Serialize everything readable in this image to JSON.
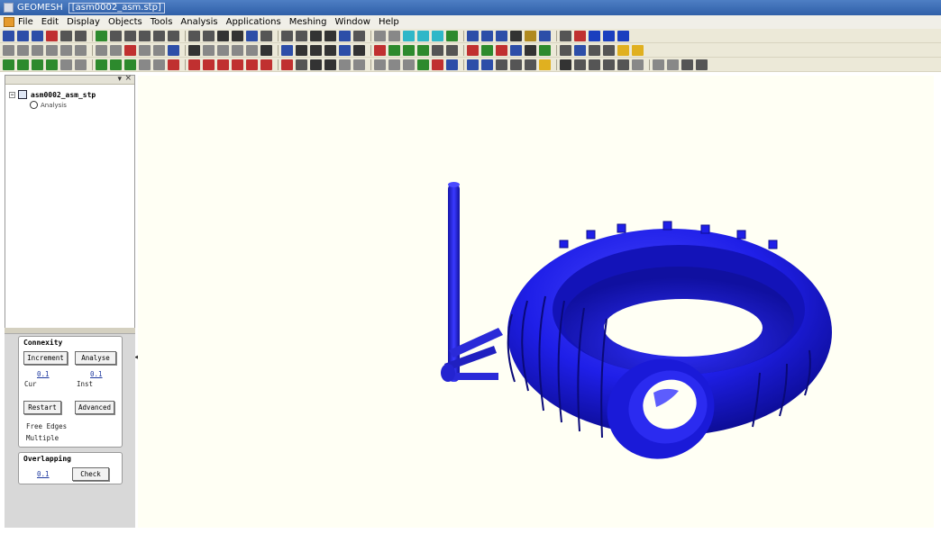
{
  "window": {
    "app_title": "GEOMESH",
    "document": "[asm0002_asm.stp]"
  },
  "menu": [
    "File",
    "Edit",
    "Display",
    "Objects",
    "Tools",
    "Analysis",
    "Applications",
    "Meshing",
    "Window",
    "Help"
  ],
  "toolbars": {
    "row1": [
      "#2d4ea8",
      "#2d4ea8",
      "#2d4ea8",
      "#c03030",
      "#555",
      "#555",
      "#2d8a2d",
      "#555",
      "#555",
      "#555",
      "#555",
      "#555",
      "#555",
      "#555",
      "#333",
      "#333",
      "#2d4ea8",
      "#555",
      "#555",
      "#555",
      "#333",
      "#333",
      "#2d4ea8",
      "#555",
      "#888",
      "#888",
      "#2fb7c8",
      "#2fb7c8",
      "#2fb7c8",
      "#2d8a2d",
      "#2d4ea8",
      "#2d4ea8",
      "#2d4ea8",
      "#333",
      "#b08a20",
      "#2d4ea8",
      "#555",
      "#c03030",
      "#1a3fbf",
      "#1a3fbf",
      "#1a3fbf"
    ],
    "row2": [
      "#888",
      "#888",
      "#888",
      "#888",
      "#888",
      "#888",
      "#888",
      "#888",
      "#c03030",
      "#888",
      "#888",
      "#2d4ea8",
      "#333",
      "#888",
      "#888",
      "#888",
      "#888",
      "#333",
      "#2d4ea8",
      "#333",
      "#333",
      "#333",
      "#2d4ea8",
      "#333",
      "#c03030",
      "#2d8a2d",
      "#2d8a2d",
      "#2d8a2d",
      "#555",
      "#555",
      "#c03030",
      "#2d8a2d",
      "#c03030",
      "#2d4ea8",
      "#333",
      "#2d8a2d",
      "#555",
      "#2d4ea8",
      "#555",
      "#555",
      "#e0b020",
      "#e0b020"
    ],
    "row3": [
      "#2d8a2d",
      "#2d8a2d",
      "#2d8a2d",
      "#2d8a2d",
      "#888",
      "#888",
      "#2d8a2d",
      "#2d8a2d",
      "#2d8a2d",
      "#888",
      "#888",
      "#c03030",
      "#c03030",
      "#c03030",
      "#c03030",
      "#c03030",
      "#c03030",
      "#c03030",
      "#c03030",
      "#555",
      "#333",
      "#333",
      "#888",
      "#888",
      "#888",
      "#888",
      "#888",
      "#2d8a2d",
      "#c03030",
      "#2d4ea8",
      "#2d4ea8",
      "#2d4ea8",
      "#555",
      "#555",
      "#555",
      "#e0b020",
      "#333",
      "#555",
      "#555",
      "#555",
      "#555",
      "#888",
      "#888",
      "#888",
      "#555",
      "#555"
    ]
  },
  "tree": {
    "root_label": "asm0002_asm_stp",
    "child_label": "Analysis"
  },
  "connectivity": {
    "title": "Connexity",
    "increment_button": "Increment",
    "analyse_button": "Analyse",
    "value1": "0.1",
    "value2": "0.1",
    "label1": "Cur",
    "label2": "Inst",
    "restart_button": "Restart",
    "advanced_button": "Advanced",
    "free_edges_label": "Free Edges",
    "multiple_label": "Multiple"
  },
  "overlapping": {
    "title": "Overlapping",
    "value": "0.1",
    "check_button": "Check"
  },
  "colors": {
    "model_blue": "#1f1fe8",
    "viewport_bg": "#fffff4"
  }
}
